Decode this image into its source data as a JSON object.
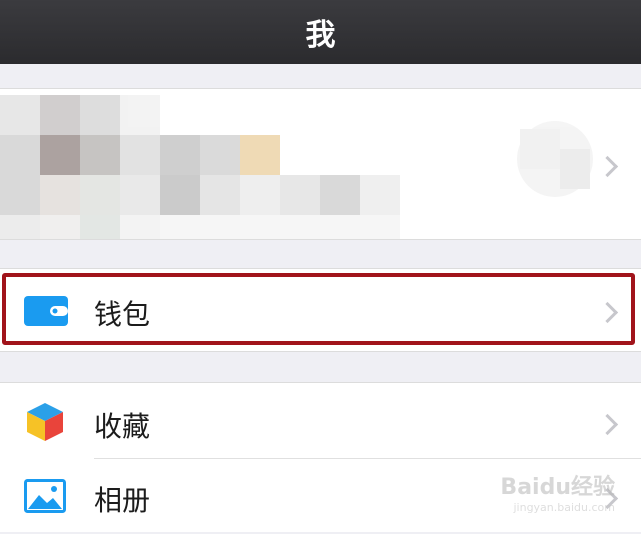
{
  "navbar": {
    "title": "我"
  },
  "menu": {
    "wallet": {
      "label": "钱包",
      "icon": "wallet-icon"
    },
    "favorites": {
      "label": "收藏",
      "icon": "favorites-cube-icon"
    },
    "album": {
      "label": "相册",
      "icon": "album-picture-icon"
    }
  },
  "watermark": {
    "brand": "Baidu经验",
    "url": "jingyan.baidu.com"
  },
  "colors": {
    "navbar": "#2f2f32",
    "highlight": "#a1141b",
    "wallet_icon": "#1a9bf0",
    "background": "#efeff4"
  }
}
